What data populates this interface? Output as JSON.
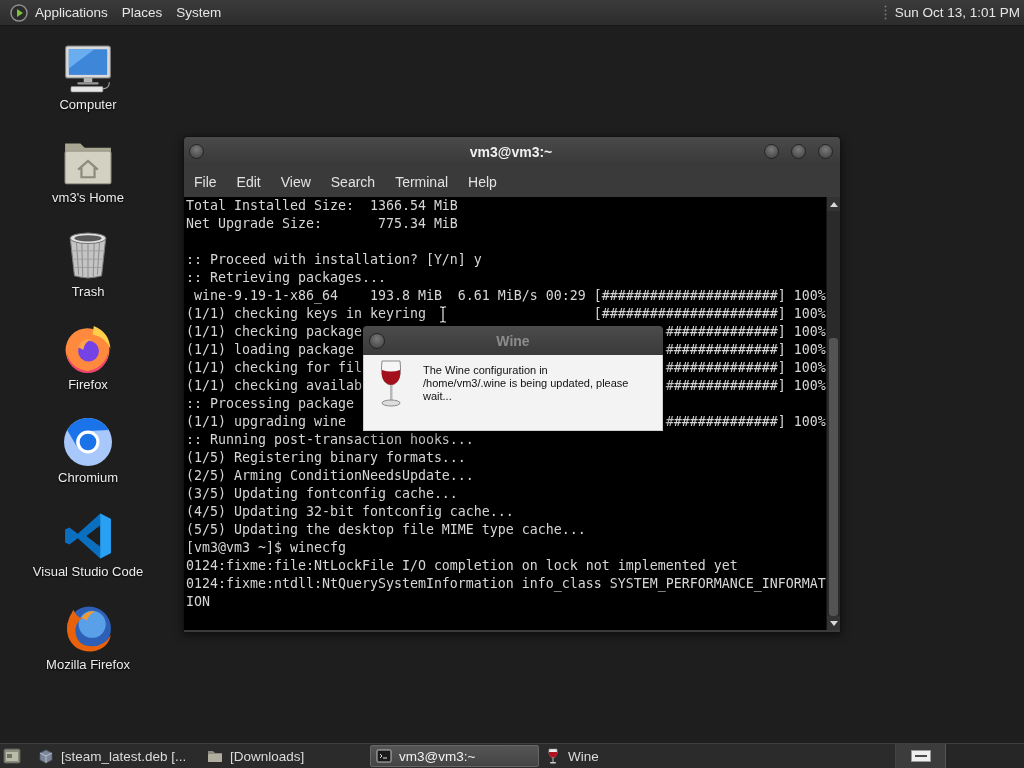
{
  "top_panel": {
    "menus": [
      "Applications",
      "Places",
      "System"
    ],
    "clock": "Sun Oct 13, 1:01 PM"
  },
  "desktop_icons": [
    {
      "label": "Computer",
      "kind": "computer"
    },
    {
      "label": "vm3's Home",
      "kind": "home"
    },
    {
      "label": "Trash",
      "kind": "trash"
    },
    {
      "label": "Firefox",
      "kind": "fox"
    },
    {
      "label": "Chromium",
      "kind": "ring"
    },
    {
      "label": "Visual Studio Code",
      "kind": "ribbon"
    },
    {
      "label": "Mozilla Firefox",
      "kind": "fox-classic"
    }
  ],
  "terminal": {
    "title": "vm3@vm3:~",
    "active": true,
    "menu": [
      "File",
      "Edit",
      "View",
      "Search",
      "Terminal",
      "Help"
    ],
    "output": [
      [
        {
          "text": "Total Installed Size:  1366.54 MiB"
        },
        {
          "text": "Net Upgrade Size:       775.34 MiB"
        }
      ],
      [
        {
          "text": ":: Proceed with installation? [Y/n] y"
        },
        {
          "text": ":: Retrieving packages..."
        },
        {
          "text": " wine-9.19-1-x86_64    193.8 MiB  6.61 MiB/s 00:29 [######################] 100%"
        },
        {
          "text": "(1/1) checking keys in keyring",
          "trailing": "[######################] 100%"
        },
        {
          "text": "(1/1) checking package",
          "trailing": "##############] 100%"
        },
        {
          "text": "(1/1) loading package",
          "trailing": "##############] 100%"
        },
        {
          "text": "(1/1) checking for fil",
          "trailing": "##############] 100%"
        },
        {
          "text": "(1/1) checking availab",
          "trailing": "##############] 100%"
        },
        {
          "text": ":: Processing package"
        },
        {
          "text": "(1/1) upgrading wine",
          "trailing": "##############] 100%"
        },
        {
          "text": ":: Running post-transaction hooks..."
        },
        {
          "text": "(1/5) Registering binary formats..."
        },
        {
          "text": "(2/5) Arming ConditionNeedsUpdate..."
        },
        {
          "text": "(3/5) Updating fontconfig cache..."
        },
        {
          "text": "(4/5) Updating 32-bit fontconfig cache..."
        },
        {
          "text": "(5/5) Updating the desktop file MIME type cache..."
        },
        {
          "text": "[vm3@vm3 ~]$ winecfg"
        },
        {
          "text": "0124:fixme:file:NtLockFile I/O completion on lock not implemented yet"
        },
        {
          "text": "0124:fixme:ntdll:NtQuerySystemInformation info_class SYSTEM_PERFORMANCE_INFORMAT"
        },
        {
          "text": "ION"
        }
      ]
    ]
  },
  "dialog": {
    "title": "Wine",
    "active": false,
    "message": "The Wine configuration in /home/vm3/.wine is being updated, please wait..."
  },
  "taskbar": {
    "tasks": [
      {
        "label": "[steam_latest.deb [...",
        "kind": "package",
        "selected": false
      },
      {
        "label": "[Downloads]",
        "kind": "folder",
        "selected": false
      },
      {
        "label": "vm3@vm3:~",
        "kind": "terminal",
        "selected": true
      },
      {
        "label": "Wine",
        "kind": "wine",
        "selected": false
      }
    ]
  }
}
